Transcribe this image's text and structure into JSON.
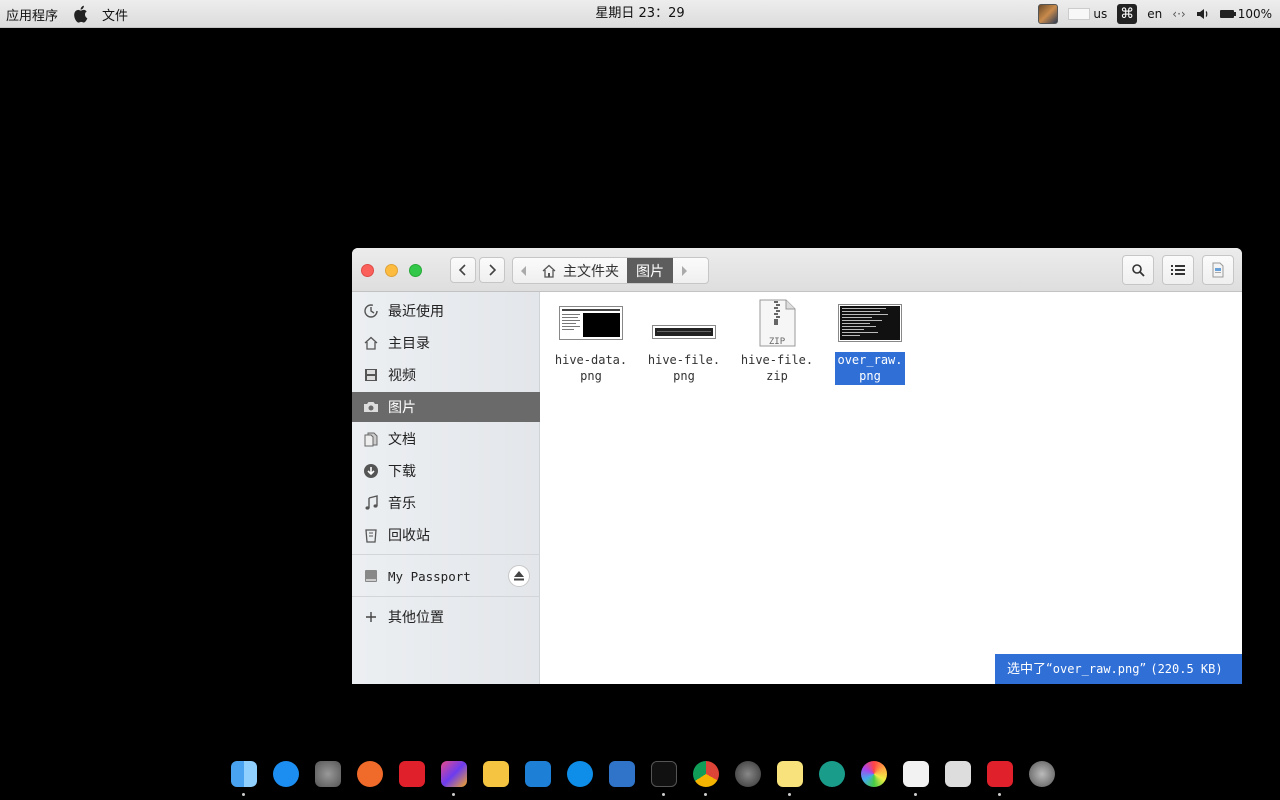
{
  "menubar": {
    "app_menu": "应用程序",
    "file_menu": "文件",
    "clock": "星期日 23：29",
    "keyboard_layout": "us",
    "language": "en",
    "battery": "100%"
  },
  "window": {
    "path": {
      "home_label": "主文件夹",
      "current_label": "图片"
    },
    "sidebar": {
      "items": [
        {
          "label": "最近使用",
          "icon": "recent-icon"
        },
        {
          "label": "主目录",
          "icon": "home-icon"
        },
        {
          "label": "视频",
          "icon": "video-icon"
        },
        {
          "label": "图片",
          "icon": "camera-icon"
        },
        {
          "label": "文档",
          "icon": "document-icon"
        },
        {
          "label": "下载",
          "icon": "download-icon"
        },
        {
          "label": "音乐",
          "icon": "music-icon"
        },
        {
          "label": "回收站",
          "icon": "trash-icon"
        }
      ],
      "active_index": 3,
      "device": "My Passport",
      "other_locations": "其他位置"
    },
    "files": [
      {
        "name_line1": "hive-data.",
        "name_line2": "png",
        "type": "image"
      },
      {
        "name_line1": "hive-file.",
        "name_line2": "png",
        "type": "image"
      },
      {
        "name_line1": "hive-file.",
        "name_line2": "zip",
        "type": "zip"
      },
      {
        "name_line1": "over_raw.",
        "name_line2": "png",
        "type": "image",
        "selected": true
      }
    ],
    "zip_badge": "ZIP",
    "status": {
      "prefix": "选中了“",
      "filename": "over_raw.png",
      "suffix": "”",
      "size": "(220.5 KB)"
    }
  },
  "colors": {
    "selection": "#2f6fd6",
    "sidebar_active": "#6a6a6a"
  },
  "dock": [
    "finder-icon",
    "app-store-icon",
    "system-preferences-icon",
    "pen-icon",
    "xmind-icon",
    "intellij-icon",
    "sketch-icon",
    "vscode-icon",
    "teamviewer-icon",
    "xcode-icon",
    "terminal-icon",
    "chrome-icon",
    "settings-icon",
    "notes-icon",
    "time-machine-icon",
    "photos-icon",
    "text-editor-icon",
    "screenshot-icon",
    "xmind2-icon",
    "launchpad-icon"
  ]
}
